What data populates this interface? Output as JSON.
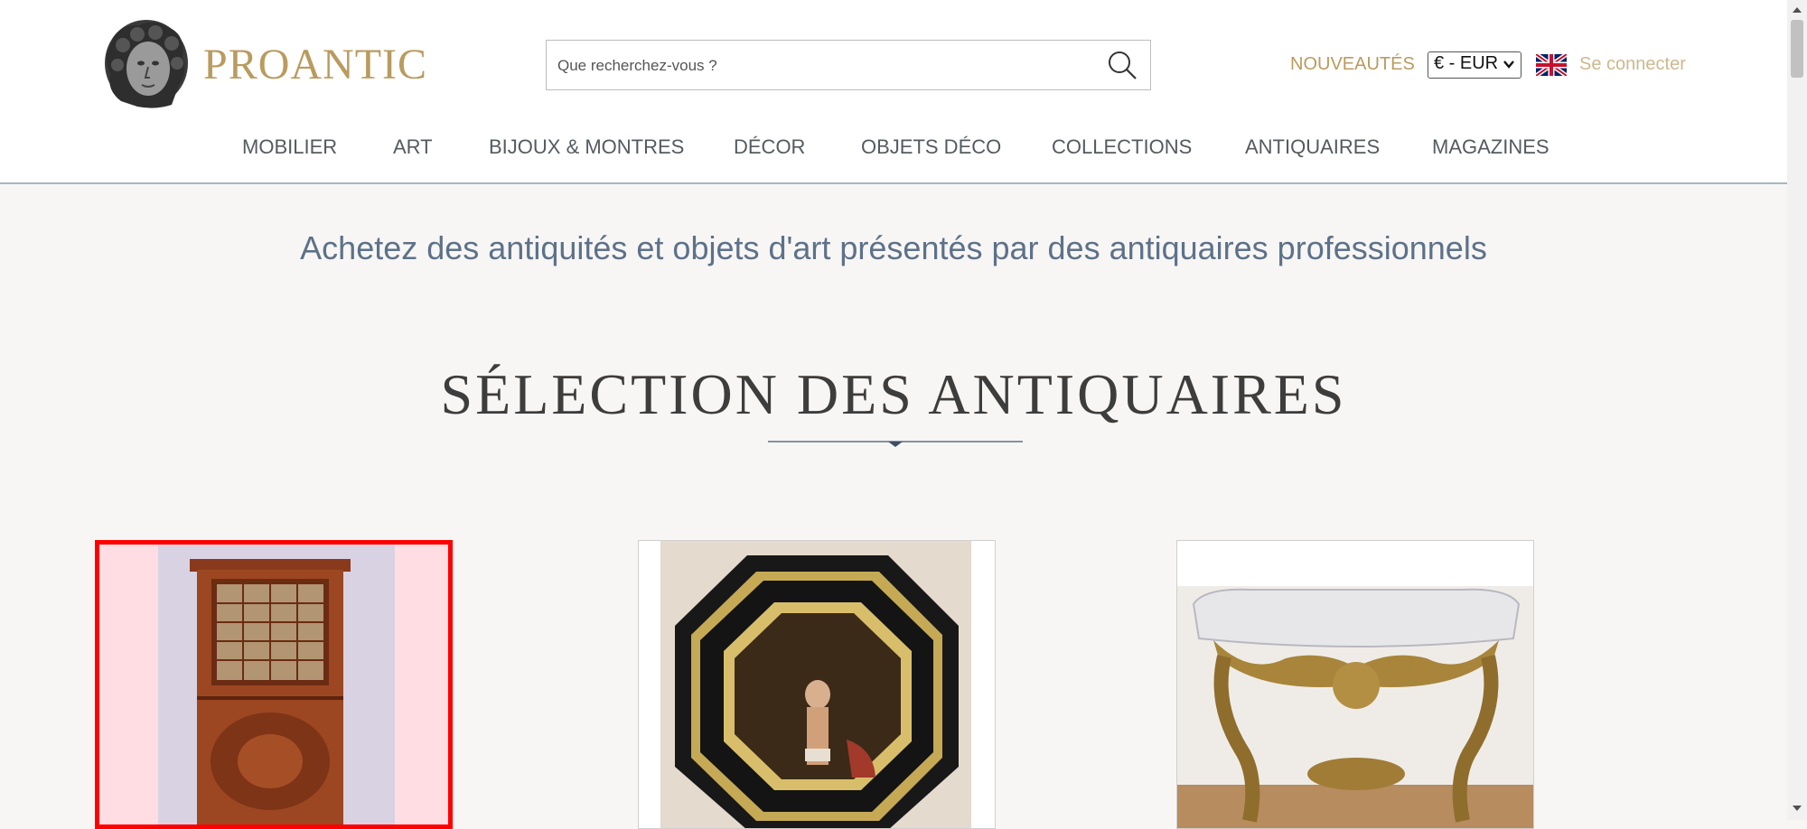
{
  "header": {
    "logo_text": "PROANTIC",
    "search_placeholder": "Que recherchez-vous ?",
    "nouveautes_label": "NOUVEAUTÉS",
    "currency_selected": "€ - EUR",
    "login_label": "Se connecter"
  },
  "nav": {
    "items": [
      {
        "label": "MOBILIER"
      },
      {
        "label": "ART"
      },
      {
        "label": "BIJOUX & MONTRES"
      },
      {
        "label": "DÉCOR"
      },
      {
        "label": "OBJETS DÉCO"
      },
      {
        "label": "COLLECTIONS"
      },
      {
        "label": "ANTIQUAIRES"
      },
      {
        "label": "MAGAZINES"
      }
    ]
  },
  "main": {
    "tagline": "Achetez des antiquités et objets d'art présentés par des antiquaires professionnels",
    "section_title": "SÉLECTION DES ANTIQUAIRES",
    "cards": [
      {
        "subject": "mahogany-secretary-cabinet",
        "selected": true
      },
      {
        "subject": "octagonal-framed-painting",
        "selected": false
      },
      {
        "subject": "gilded-marble-console",
        "selected": false
      }
    ]
  },
  "colors": {
    "brand_gold": "#b99b5e",
    "nav_text": "#555a60",
    "tagline_blue": "#5d7189",
    "selection_red": "#ff0000"
  },
  "icons": [
    "logo-head-icon",
    "search-icon",
    "chevron-down-icon",
    "uk-flag-icon"
  ]
}
